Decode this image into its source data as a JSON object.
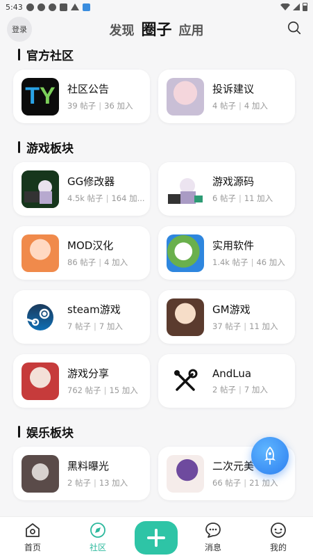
{
  "status_bar": {
    "time": "5:43"
  },
  "header": {
    "login_label": "登录",
    "tabs": [
      {
        "label": "发现",
        "active": false
      },
      {
        "label": "圈子",
        "active": true
      },
      {
        "label": "应用",
        "active": false
      }
    ]
  },
  "sections": [
    {
      "title": "官方社区",
      "cards": [
        {
          "name": "社区公告",
          "posts": "39 帖子",
          "joined": "36 加入",
          "thumb": "ty-logo"
        },
        {
          "name": "投诉建议",
          "posts": "4 帖子",
          "joined": "4 加入",
          "thumb": "anime-girl-pink"
        }
      ]
    },
    {
      "title": "游戏板块",
      "cards": [
        {
          "name": "GG修改器",
          "posts": "4.5k 帖子",
          "joined": "164 加...",
          "thumb": "anime-gg"
        },
        {
          "name": "游戏源码",
          "posts": "6 帖子",
          "joined": "11 加入",
          "thumb": "anime-computer"
        },
        {
          "name": "MOD汉化",
          "posts": "86 帖子",
          "joined": "4 加入",
          "thumb": "anime-orange"
        },
        {
          "name": "实用软件",
          "posts": "1.4k 帖子",
          "joined": "46 加入",
          "thumb": "anime-earth"
        },
        {
          "name": "steam游戏",
          "posts": "7 帖子",
          "joined": "7 加入",
          "thumb": "steam-logo"
        },
        {
          "name": "GM游戏",
          "posts": "37 帖子",
          "joined": "11 加入",
          "thumb": "anime-guitar"
        },
        {
          "name": "游戏分享",
          "posts": "762 帖子",
          "joined": "15 加入",
          "thumb": "anime-white-hair"
        },
        {
          "name": "AndLua",
          "posts": "2 帖子",
          "joined": "7 加入",
          "thumb": "tools-icon"
        }
      ]
    },
    {
      "title": "娱乐板块",
      "cards": [
        {
          "name": "黑料曝光",
          "posts": "2 帖子",
          "joined": "13 加入",
          "thumb": "photo-dark"
        },
        {
          "name": "二次元美",
          "posts": "66 帖子",
          "joined": "21 加入",
          "thumb": "anime-purple"
        }
      ]
    }
  ],
  "bottom_nav": [
    {
      "label": "首页",
      "icon": "home-icon",
      "active": false
    },
    {
      "label": "社区",
      "icon": "compass-icon",
      "active": true
    },
    {
      "label": "",
      "icon": "plus-icon",
      "active": false
    },
    {
      "label": "消息",
      "icon": "message-icon",
      "active": false
    },
    {
      "label": "我的",
      "icon": "profile-icon",
      "active": false
    }
  ],
  "colors": {
    "accent": "#2ec4a6",
    "fab": "#2c7ef0"
  }
}
